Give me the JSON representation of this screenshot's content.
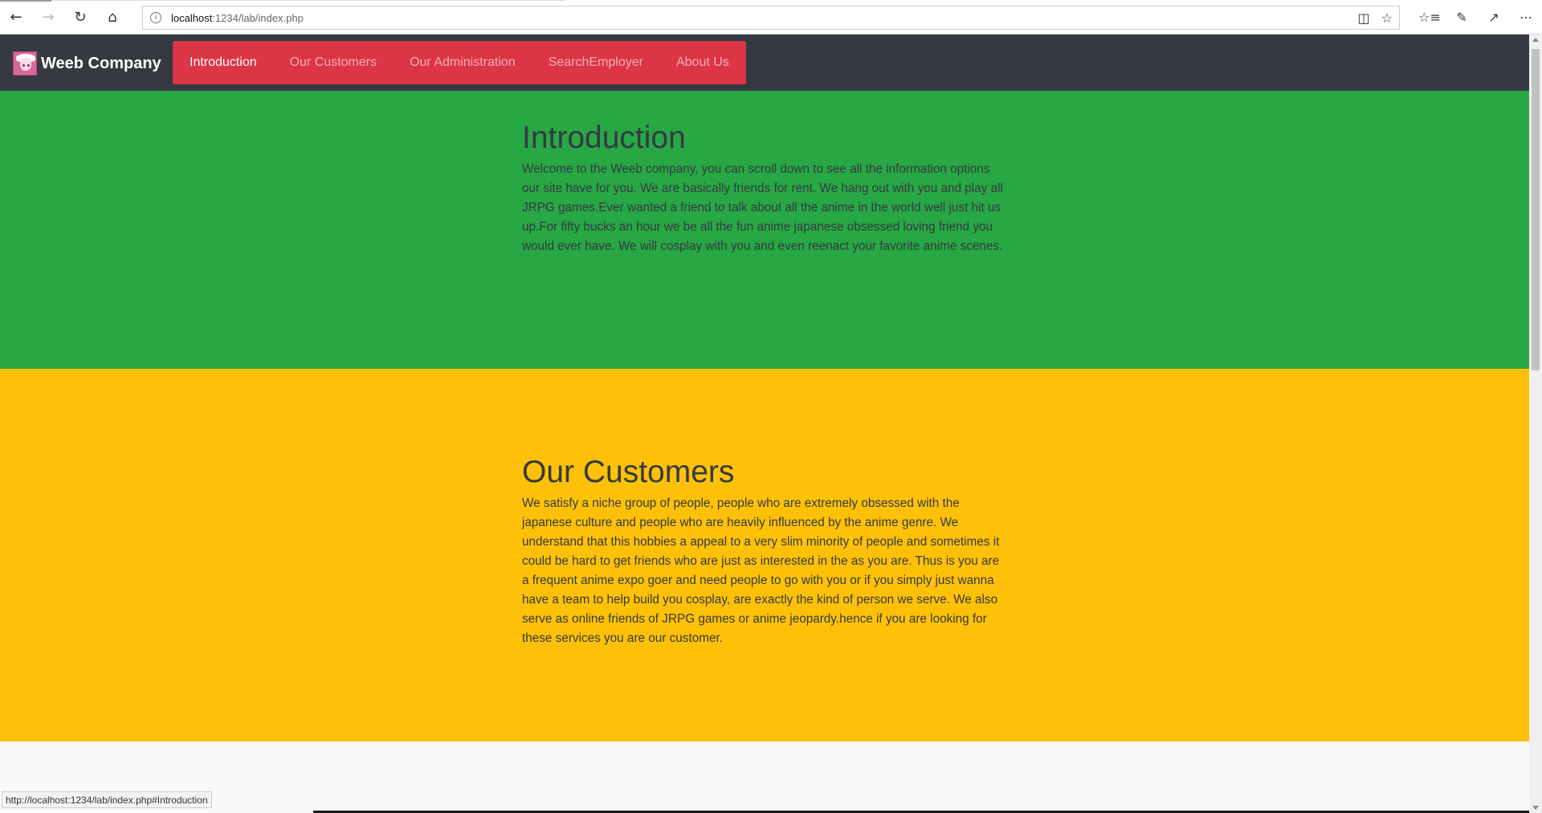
{
  "browser": {
    "url_host": "localhost",
    "url_rest": ":1234/lab/index.php",
    "back_icon": "back-arrow-icon",
    "forward_icon": "forward-arrow-icon",
    "refresh_icon": "refresh-icon",
    "home_icon": "home-icon",
    "status_url": "http://localhost:1234/lab/index.php#Introduction"
  },
  "site": {
    "brand": "Weeb Company",
    "nav": [
      {
        "label": "Introduction"
      },
      {
        "label": "Our Customers"
      },
      {
        "label": "Our Administration"
      },
      {
        "label": "SearchEmployer"
      },
      {
        "label": "About Us"
      }
    ]
  },
  "sections": {
    "introduction": {
      "title": "Introduction",
      "body": "Welcome to the Weeb company, you can scroll down to see all the information options our site have for you. We are basically friends for rent. We hang out with you and play all JRPG games.Ever wanted a friend to talk about all the anime in the world well just hit us up.For fifty bucks an hour we be all the fun anime japanese obsessed loving friend you would ever have. We will cosplay with you and even reenact your favorite anime scenes."
    },
    "customers": {
      "title": "Our Customers",
      "body": "We satisfy a niche group of people, people who are extremely obsessed with the japanese culture and people who are heavily influenced by the anime genre. We understand that this hobbies a appeal to a very slim minority of people and sometimes it could be hard to get friends who are just as interested in the as you are. Thus is you are a frequent anime expo goer and need people to go with you or if you simply just wanna have a team to help build you cosplay, are exactly the kind of person we serve. We also serve as online friends of JRPG games or anime jeopardy.hence if you are looking for these services you are our customer."
    }
  },
  "colors": {
    "navbar": "#343a40",
    "nav_links_bg": "#dc3545",
    "intro_bg": "#28a745",
    "customers_bg": "#ffc107"
  }
}
